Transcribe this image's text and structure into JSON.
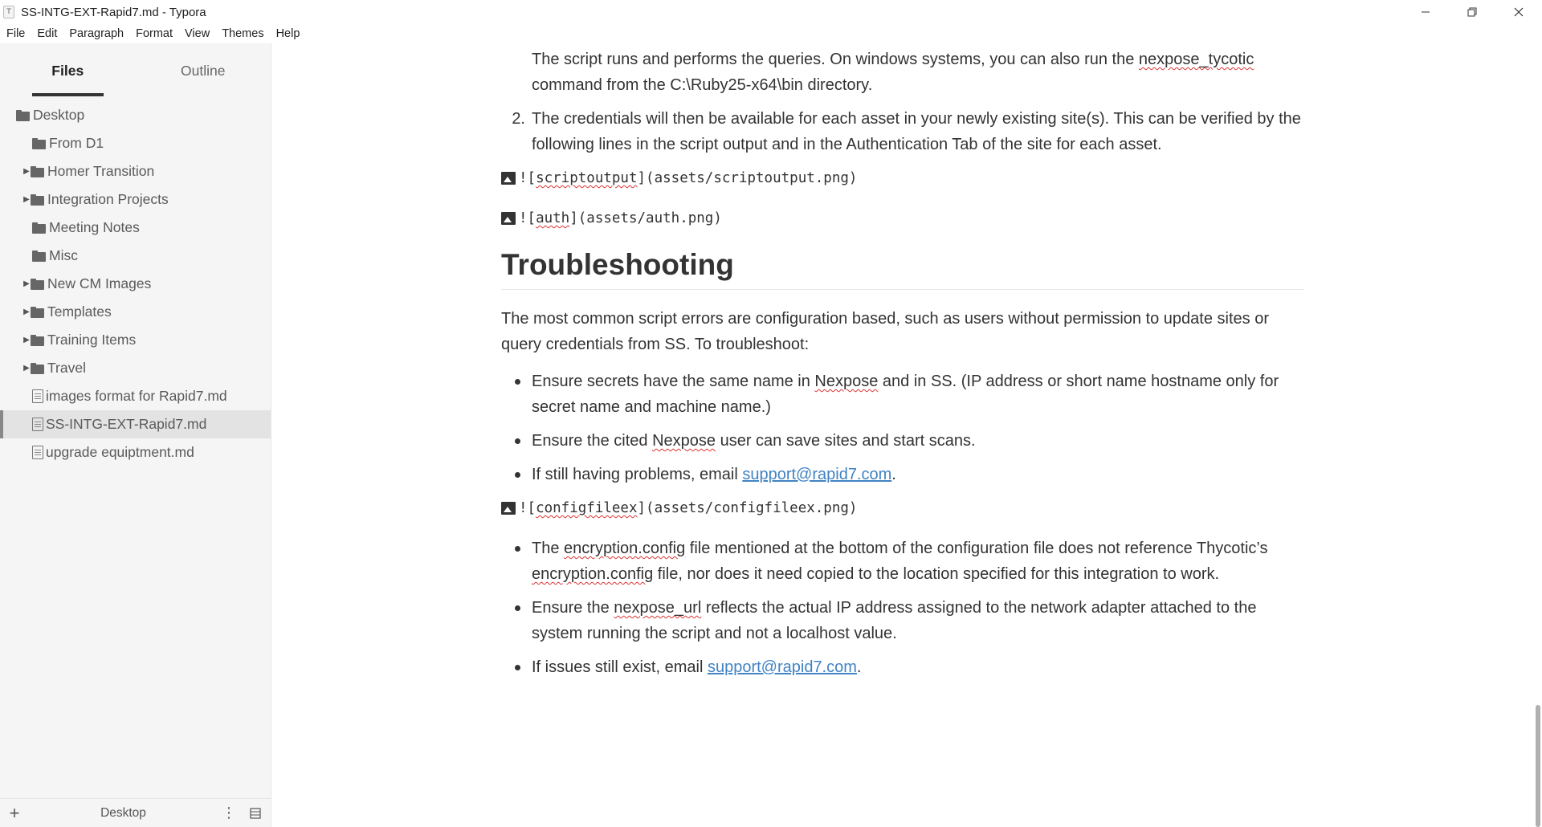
{
  "window": {
    "app_icon_letter": "T",
    "title": "SS-INTG-EXT-Rapid7.md - Typora"
  },
  "menu": [
    "File",
    "Edit",
    "Paragraph",
    "Format",
    "View",
    "Themes",
    "Help"
  ],
  "sidebar": {
    "tabs": {
      "files": "Files",
      "outline": "Outline"
    },
    "items": [
      {
        "label": "Desktop"
      },
      {
        "label": "From D1"
      },
      {
        "label": "Homer Transition"
      },
      {
        "label": "Integration Projects"
      },
      {
        "label": "Meeting Notes"
      },
      {
        "label": "Misc"
      },
      {
        "label": "New CM Images"
      },
      {
        "label": "Templates"
      },
      {
        "label": "Training Items"
      },
      {
        "label": "Travel"
      },
      {
        "label": "images format for Rapid7.md"
      },
      {
        "label": "SS-INTG-EXT-Rapid7.md"
      },
      {
        "label": "upgrade equiptment.md"
      }
    ],
    "footer_label": "Desktop"
  },
  "doc": {
    "p1_a": "The script runs and performs the queries. On windows systems, you can also run the ",
    "p1_code": "nexpose_tycotic",
    "p1_b": "command from the C:\\Ruby25-x64\\bin directory.",
    "li2_num": "2.",
    "li2_text": "The credentials will then be available for each asset in your newly existing site(s). This can be verified by the following lines in the script output and in the Authentication Tab of the site for each asset.",
    "img1_open": "![",
    "img1_alt": "scriptoutput",
    "img1_rest": "](assets/scriptoutput.png)",
    "img2_open": "![",
    "img2_alt": "auth",
    "img2_rest": "](assets/auth.png)",
    "heading": "Troubleshooting",
    "intro": "The most common script errors are configuration based, such as users without permission to update sites or query credentials from SS. To troubleshoot:",
    "b1_a": "Ensure secrets have the same name in ",
    "b1_word": "Nexpose",
    "b1_b": " and in SS. (IP address or short name hostname only for secret name and machine name.)",
    "b2_a": "Ensure the cited ",
    "b2_word": "Nexpose",
    "b2_b": " user can save sites and start scans.",
    "b3_a": "If still having problems, email ",
    "b3_link": "support@rapid7.com",
    "b3_b": ".",
    "img3_open": "![",
    "img3_alt": "configfileex",
    "img3_rest": "](assets/configfileex.png)",
    "c1_a": "The ",
    "c1_w1": "encryption.config",
    "c1_b": " file mentioned at the bottom of the configuration file does not reference Thycotic’s ",
    "c1_w2": "encryption.config",
    "c1_c": " file, nor does it need copied to the location specified for this integration to work.",
    "c2_a": "Ensure the ",
    "c2_word": "nexpose_url",
    "c2_b": " reflects the actual IP address assigned to the network adapter attached to the system running the script and not a localhost value.",
    "c3_a": "If issues still exist, email ",
    "c3_link": "support@rapid7.com",
    "c3_b": "."
  }
}
